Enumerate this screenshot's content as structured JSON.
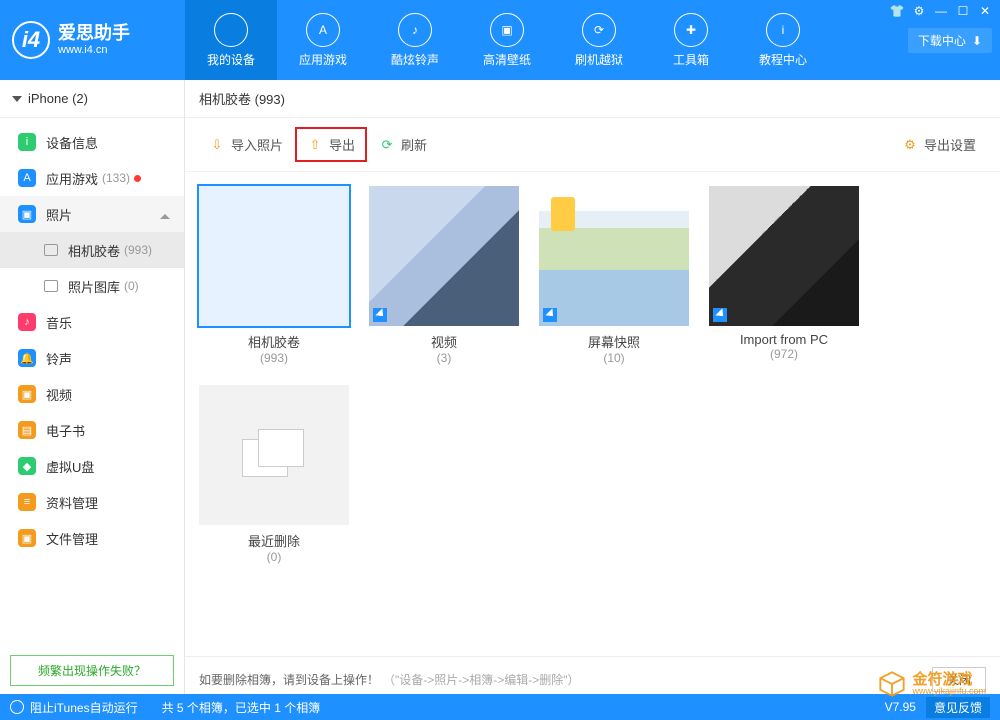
{
  "brand": {
    "title": "爱思助手",
    "url": "www.i4.cn"
  },
  "nav": [
    "我的设备",
    "应用游戏",
    "酷炫铃声",
    "高清壁纸",
    "刷机越狱",
    "工具箱",
    "教程中心"
  ],
  "winbar": {
    "download_center": "下载中心"
  },
  "device_bar": "iPhone (2)",
  "sidebar": {
    "items": [
      {
        "label": "设备信息",
        "color": "#2ecc71",
        "glyph": "i"
      },
      {
        "label": "应用游戏",
        "color": "#1e90ff",
        "glyph": "A",
        "count": "(133)",
        "dot": true
      },
      {
        "label": "照片",
        "color": "#1e90ff",
        "glyph": "▣",
        "selected": true,
        "expandable": true,
        "subs": [
          {
            "label": "相机胶卷",
            "count": "(993)",
            "active": true
          },
          {
            "label": "照片图库",
            "count": "(0)"
          }
        ]
      },
      {
        "label": "音乐",
        "color": "#ff3b6b",
        "glyph": "♪"
      },
      {
        "label": "铃声",
        "color": "#1e90ff",
        "glyph": "🔔"
      },
      {
        "label": "视频",
        "color": "#f29b1d",
        "glyph": "▣"
      },
      {
        "label": "电子书",
        "color": "#f29b1d",
        "glyph": "▤"
      },
      {
        "label": "虚拟U盘",
        "color": "#2ecc71",
        "glyph": "◆"
      },
      {
        "label": "资料管理",
        "color": "#f29b1d",
        "glyph": "≡"
      },
      {
        "label": "文件管理",
        "color": "#f29b1d",
        "glyph": "▣"
      }
    ],
    "help": "频繁出现操作失败？"
  },
  "crumb": "相机胶卷  (993)",
  "toolbar": {
    "import": "导入照片",
    "export": "导出",
    "refresh": "刷新",
    "settings": "导出设置"
  },
  "albums": [
    {
      "title": "相机胶卷",
      "count": "(993)",
      "thumb_class": "tA",
      "selected": true
    },
    {
      "title": "视频",
      "count": "(3)",
      "thumb_class": "tA",
      "corner": true
    },
    {
      "title": "屏幕快照",
      "count": "(10)",
      "thumb_class": "tB",
      "corner": true
    },
    {
      "title": "Import from PC",
      "count": "(972)",
      "thumb_class": "tC",
      "corner": true
    },
    {
      "title": "最近删除",
      "count": "(0)",
      "placeholder": true
    }
  ],
  "hint": {
    "text": "如要删除相簿，请到设备上操作！",
    "gray": "（\"设备->照片->相簿->编辑->删除\"）",
    "close": "关闭"
  },
  "footer": {
    "itunes": "阻止iTunes自动运行",
    "status": "共 5 个相簿，已选中 1 个相簿",
    "version": "V7.95",
    "feedback": "意见反馈"
  },
  "watermark": {
    "cn": "金符游戏",
    "en": "www.yikajinfu.com"
  }
}
